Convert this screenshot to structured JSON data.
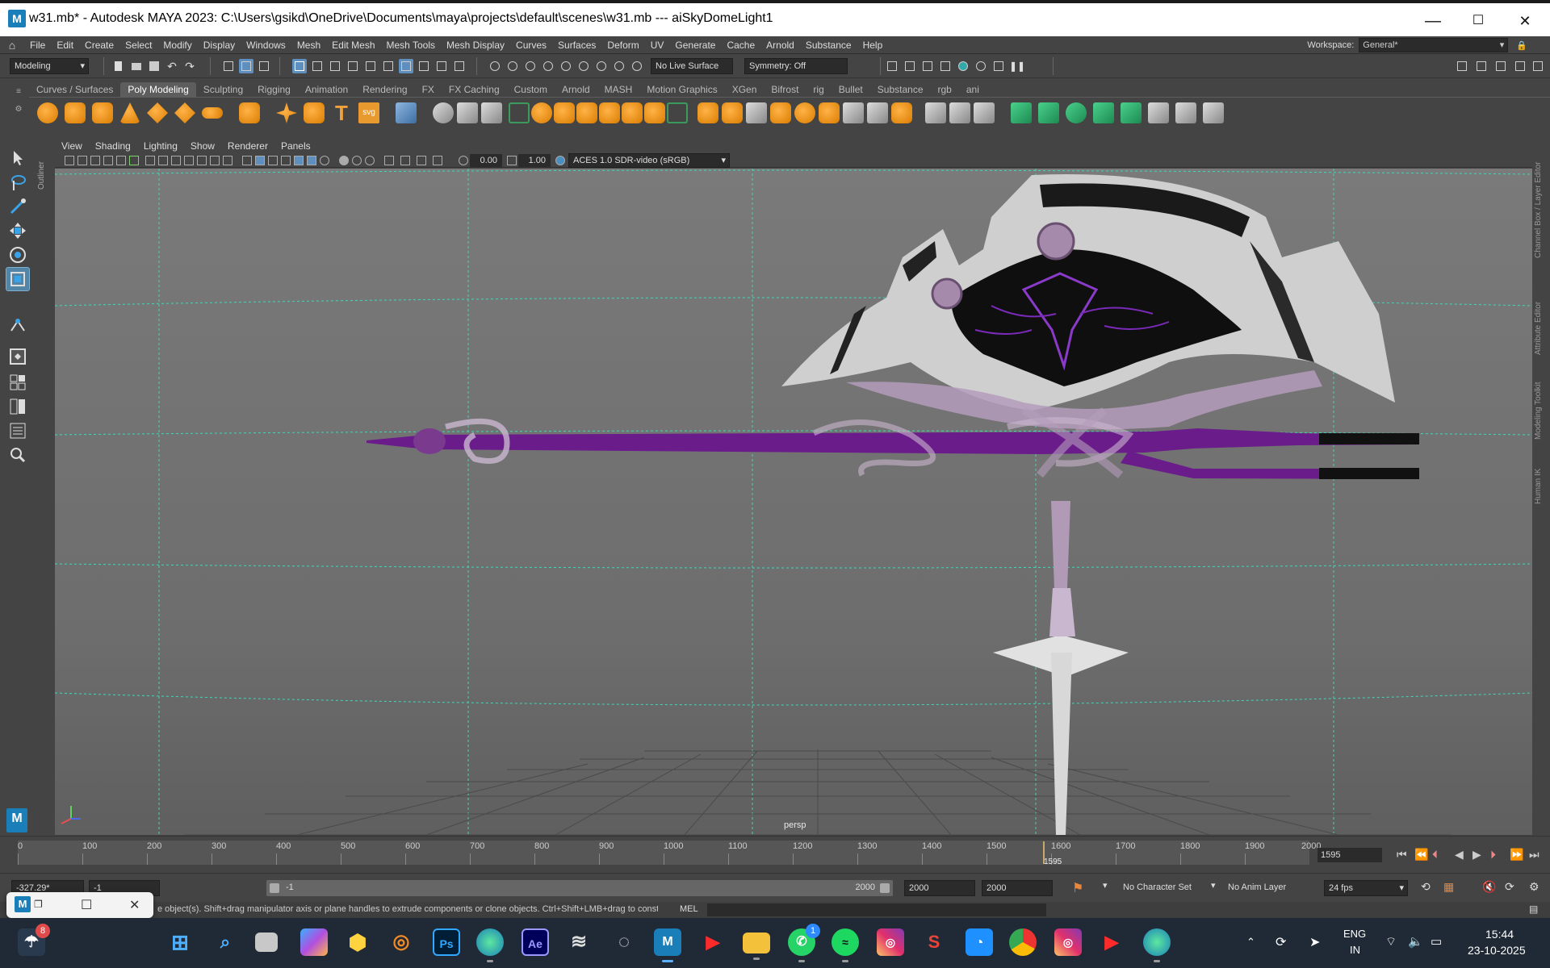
{
  "window": {
    "title": "w31.mb* - Autodesk MAYA 2023: C:\\Users\\gsikd\\OneDrive\\Documents\\maya\\projects\\default\\scenes\\w31.mb   ---   aiSkyDomeLight1",
    "app_icon": "M",
    "min": "—",
    "max": "☐",
    "close": "✕"
  },
  "menubar": {
    "items": [
      "File",
      "Edit",
      "Create",
      "Select",
      "Modify",
      "Display",
      "Windows",
      "Mesh",
      "Edit Mesh",
      "Mesh Tools",
      "Mesh Display",
      "Curves",
      "Surfaces",
      "Deform",
      "UV",
      "Generate",
      "Cache",
      "Arnold",
      "Substance",
      "Help"
    ],
    "workspace_label": "Workspace:",
    "workspace_value": "General*"
  },
  "statusline": {
    "mode": "Modeling",
    "live_surface": "No Live Surface",
    "symmetry": "Symmetry: Off"
  },
  "shelf": {
    "tabs": [
      "Curves / Surfaces",
      "Poly Modeling",
      "Sculpting",
      "Rigging",
      "Animation",
      "Rendering",
      "FX",
      "FX Caching",
      "Custom",
      "Arnold",
      "MASH",
      "Motion Graphics",
      "XGen",
      "Bifrost",
      "rig",
      "Bullet",
      "Substance",
      "rgb",
      "ani"
    ],
    "active_tab": "Poly Modeling",
    "text_tool": "T",
    "svg_tool": "svg"
  },
  "panel": {
    "menus": [
      "View",
      "Shading",
      "Lighting",
      "Show",
      "Renderer",
      "Panels"
    ],
    "exposure": "0.00",
    "gamma": "1.00",
    "color_space": "ACES 1.0 SDR-video (sRGB)",
    "camera": "persp"
  },
  "side_tabs": {
    "outliner": "Outliner",
    "right": [
      "Channel Box / Layer Editor",
      "Attribute Editor",
      "Modeling Toolkit",
      "Human IK"
    ]
  },
  "timeline": {
    "ticks": [
      "0",
      "100",
      "200",
      "300",
      "400",
      "500",
      "600",
      "700",
      "800",
      "900",
      "1000",
      "1100",
      "1200",
      "1300",
      "1400",
      "1500",
      "1600",
      "1700",
      "1800",
      "1900",
      "2000"
    ],
    "current_frame": "1595",
    "current_frame_field": "1595"
  },
  "range": {
    "coord": "-327.29*",
    "start": "-1",
    "slider_start": "-1",
    "slider_end": "2000",
    "end": "2000",
    "anim_end": "2000",
    "character_set": "No Character Set",
    "anim_layer": "No Anim Layer",
    "fps": "24 fps"
  },
  "helpline": {
    "text": "e object(s). Shift+drag manipulator axis or plane handles to extrude components or clone objects. Ctrl+Shift+LMB+drag to constrain scaling to",
    "mel": "MEL"
  },
  "taskbar": {
    "weather_badge": "8",
    "whatsapp_badge": "1",
    "language": "ENG",
    "region": "IN",
    "time": "15:44",
    "date": "23-10-2025",
    "apps": [
      "Start",
      "Search",
      "Task View",
      "Copilot",
      "Notes",
      "Blender",
      "Photoshop",
      "Edge",
      "After Effects",
      "Figma",
      "DaVinci",
      "Maya",
      "YouTube",
      "File Explorer",
      "WhatsApp",
      "Spotify",
      "Instagram",
      "Substance",
      "Blender Light",
      "Chrome",
      "Instagram",
      "YouTube",
      "Edge Dev"
    ]
  },
  "popup": {
    "m": "M",
    "restore": "❐",
    "square": "☐",
    "close": "✕"
  }
}
